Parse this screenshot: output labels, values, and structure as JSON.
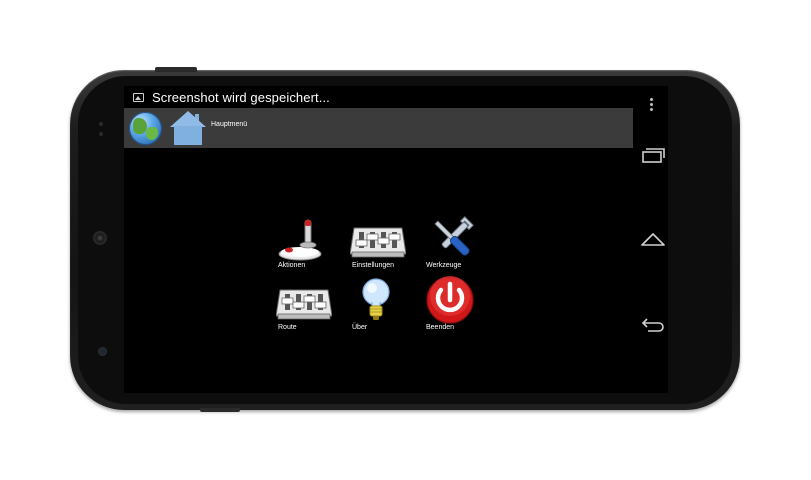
{
  "status_bar": {
    "notification_icon": "image-icon",
    "text": "Screenshot wird gespeichert..."
  },
  "action_bar": {
    "app_icon": "globe-icon",
    "home_icon": "home-icon",
    "breadcrumb": "Hauptmenü"
  },
  "menu": {
    "items": [
      {
        "label": "Aktionen",
        "icon": "joystick-icon"
      },
      {
        "label": "Einstellungen",
        "icon": "mixer-settings-icon"
      },
      {
        "label": "Werkzeuge",
        "icon": "tools-icon"
      },
      {
        "label": "Route",
        "icon": "mixer-route-icon"
      },
      {
        "label": "Über",
        "icon": "lightbulb-icon"
      },
      {
        "label": "Beenden",
        "icon": "power-icon"
      }
    ]
  },
  "navigation": {
    "buttons": [
      "recent-apps-icon",
      "home-nav-icon",
      "back-icon"
    ],
    "overflow": "overflow-menu-icon"
  }
}
